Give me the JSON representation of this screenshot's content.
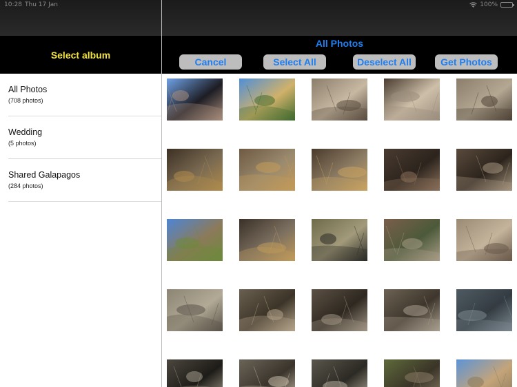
{
  "status_bar": {
    "time": "10:28",
    "date": "Thu 17 Jan",
    "battery": "100%",
    "icons": [
      "wifi-icon",
      "battery-icon"
    ]
  },
  "left_pane": {
    "title": "Select album",
    "albums": [
      {
        "name": "All Photos",
        "count": "(708 photos)"
      },
      {
        "name": "Wedding",
        "count": "(5 photos)"
      },
      {
        "name": "Shared Galapagos",
        "count": "(284 photos)"
      }
    ]
  },
  "right_pane": {
    "title": "All Photos",
    "buttons": {
      "cancel": "Cancel",
      "select_all": "Select All",
      "deselect_all": "Deselect All",
      "get_photos": "Get Photos"
    },
    "photos": [
      {
        "subject": "bird-on-branches",
        "colors": [
          "#6fa2e6",
          "#a88d7b",
          "#1d1d24"
        ]
      },
      {
        "subject": "tree-foliage-sky",
        "colors": [
          "#4f8fd8",
          "#3f6b2f",
          "#d0b16a"
        ]
      },
      {
        "subject": "blurred-bird",
        "colors": [
          "#8a7d6a",
          "#5a4c3e",
          "#c7b8a2"
        ]
      },
      {
        "subject": "dry-twigs-bird",
        "colors": [
          "#4a3c30",
          "#9a8c7c",
          "#cdbfa8"
        ]
      },
      {
        "subject": "bird-on-ground",
        "colors": [
          "#8b7d6b",
          "#4e4236",
          "#b4a893"
        ]
      },
      {
        "subject": "land-iguana-shade",
        "colors": [
          "#3c3023",
          "#b08b4c",
          "#7a6a52"
        ]
      },
      {
        "subject": "land-iguana",
        "colors": [
          "#6e5a42",
          "#c49a58",
          "#9a8a6e"
        ]
      },
      {
        "subject": "land-iguana-ground",
        "colors": [
          "#4a3a2b",
          "#c9a360",
          "#8c7c64"
        ]
      },
      {
        "subject": "dark-iguana",
        "colors": [
          "#4a3b30",
          "#8a6f5a",
          "#2c241d"
        ]
      },
      {
        "subject": "bird-dry-ground",
        "colors": [
          "#5a4a3c",
          "#a79680",
          "#2c241c"
        ]
      },
      {
        "subject": "landscape-sky",
        "colors": [
          "#4d86d4",
          "#6c8a3a",
          "#8c7a5a"
        ]
      },
      {
        "subject": "iguana-rocks",
        "colors": [
          "#3a3026",
          "#c09a5a",
          "#7b6f60"
        ]
      },
      {
        "subject": "bird-bushes",
        "colors": [
          "#6d6a4a",
          "#2a2a26",
          "#a29a7a"
        ]
      },
      {
        "subject": "dry-brush",
        "colors": [
          "#7a5e4c",
          "#a89c86",
          "#4c5a3a"
        ]
      },
      {
        "subject": "dry-path",
        "colors": [
          "#9a8a74",
          "#6a5a4a",
          "#c4b49c"
        ]
      },
      {
        "subject": "tortoise-shell",
        "colors": [
          "#8c8474",
          "#5a5248",
          "#b2aa96"
        ]
      },
      {
        "subject": "tortoise-head",
        "colors": [
          "#6a6050",
          "#b4a48a",
          "#3c3428"
        ]
      },
      {
        "subject": "leaf-litter",
        "colors": [
          "#5c5044",
          "#a09484",
          "#2e2820"
        ]
      },
      {
        "subject": "ground-litter",
        "colors": [
          "#6c6254",
          "#a89e8e",
          "#3e362c"
        ]
      },
      {
        "subject": "tortoise-shell-closeup",
        "colors": [
          "#4e5a62",
          "#7c8890",
          "#343c42"
        ]
      },
      {
        "subject": "tortoise-head-2",
        "colors": [
          "#4c463e",
          "#a29a8a",
          "#1e1c18"
        ]
      },
      {
        "subject": "tortoise-face",
        "colors": [
          "#6a6458",
          "#c4b8a4",
          "#3a342c"
        ]
      },
      {
        "subject": "tortoise-shell-2",
        "colors": [
          "#5a564c",
          "#b2aa9a",
          "#2c2a24"
        ]
      },
      {
        "subject": "tortoise-bushes",
        "colors": [
          "#5e6a3a",
          "#8a7c64",
          "#3a3428"
        ]
      },
      {
        "subject": "bird-sky",
        "colors": [
          "#5c94d6",
          "#8a7a5a",
          "#c4a47a"
        ]
      }
    ]
  }
}
